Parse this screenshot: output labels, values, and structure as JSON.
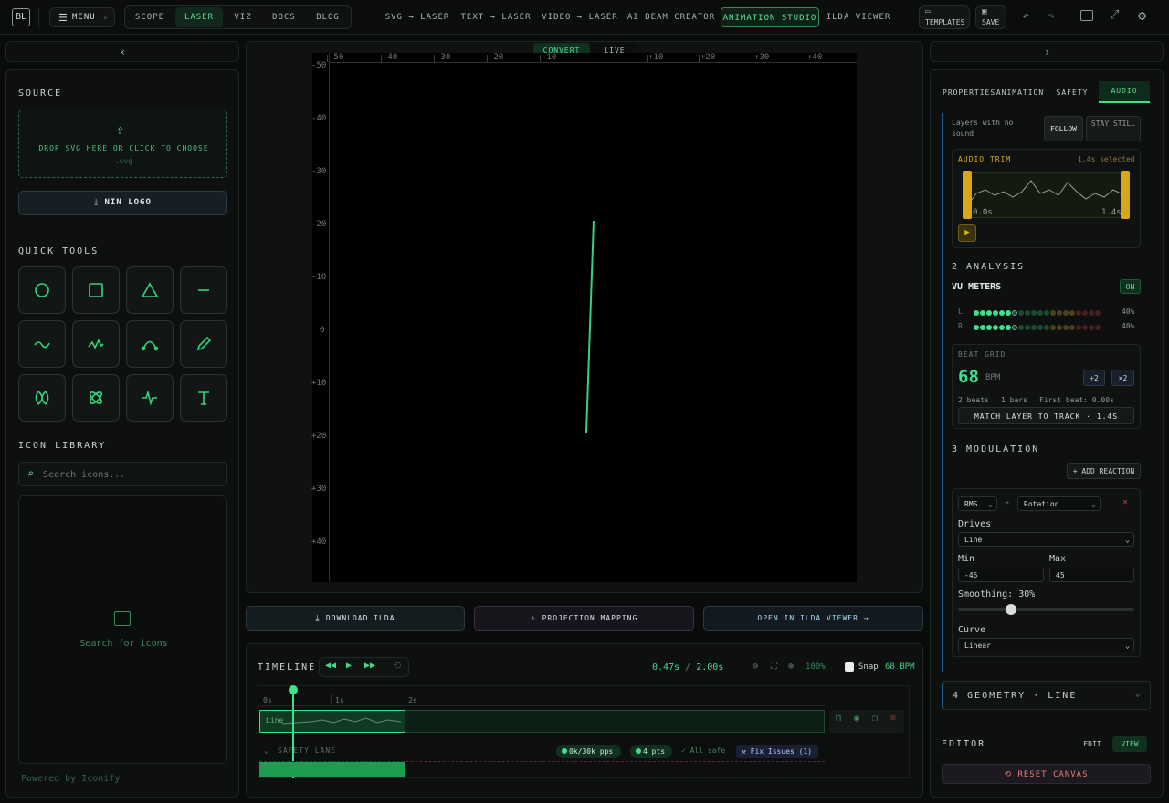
{
  "app": {
    "logo": "BL",
    "menu_label": "MENU"
  },
  "nav": {
    "primary": [
      "SCOPE",
      "LASER",
      "VIZ",
      "DOCS",
      "BLOG"
    ],
    "active": "LASER",
    "secondary": [
      "SVG → LASER",
      "TEXT → LASER",
      "VIDEO → LASER",
      "AI BEAM CREATOR",
      "ANIMATION STUDIO",
      "ILDA VIEWER"
    ],
    "secondary_active": "ANIMATION STUDIO",
    "templates": "TEMPLATES",
    "save": "SAVE"
  },
  "left": {
    "source_title": "SOURCE",
    "drop_text": "DROP SVG HERE OR CLICK TO CHOOSE",
    "drop_ext": ".svg",
    "nin_logo": "NIN LOGO",
    "quick_tools": "QUICK TOOLS",
    "tools": [
      "circle-tool-icon",
      "square-tool-icon",
      "triangle-tool-icon",
      "line-tool-icon",
      "wave-tool-icon",
      "zigzag-tool-icon",
      "arc-tool-icon",
      "pencil-tool-icon",
      "lissajous-tool-icon",
      "atom-tool-icon",
      "pulse-tool-icon",
      "text-tool-icon"
    ],
    "icon_library": "ICON LIBRARY",
    "search_placeholder": "Search icons...",
    "search_empty": "Search for icons",
    "powered": "Powered by Iconify"
  },
  "canvas": {
    "mode_tabs": [
      "CONVERT",
      "LIVE"
    ],
    "mode_active": "CONVERT",
    "x_ticks": [
      "-50",
      "-40",
      "-30",
      "-20",
      "-10",
      "+10",
      "+20",
      "+30",
      "+40"
    ],
    "y_ticks": [
      "-50",
      "-40",
      "-30",
      "-20",
      "-10",
      "0",
      "+10",
      "+20",
      "+30",
      "+40"
    ],
    "beam_color": "#34d27a",
    "download": "DOWNLOAD ILDA",
    "projection": "PROJECTION MAPPING",
    "open_viewer": "OPEN IN ILDA VIEWER →"
  },
  "timeline": {
    "title": "TIMELINE",
    "time_current": "0.47s",
    "time_sep": "/",
    "time_total": "2.00s",
    "zoom": "100%",
    "snap": "Snap",
    "bpm": "68 BPM",
    "ruler": [
      "0s",
      "1s",
      "2s"
    ],
    "clip_label": "Line",
    "safety_lane": "SAFETY LANE",
    "pps": "0k/30k pps",
    "pts": "4 pts",
    "all_safe": "✓ All safe",
    "fix": "Fix Issues (1)"
  },
  "right": {
    "tabs": [
      "PROPERTIES",
      "ANIMATION",
      "SAFETY",
      "AUDIO"
    ],
    "tab_active": "AUDIO",
    "no_sound": "Layers with no sound",
    "follow": "FOLLOW",
    "stay": "STAY STILL",
    "audio_trim": "AUDIO TRIM",
    "selected": "1.4s selected",
    "trim_start": "0.0s",
    "trim_end": "1.4s",
    "analysis": "2 ANALYSIS",
    "vu_meters": "VU METERS",
    "on": "ON",
    "vu_l": "L",
    "vu_r": "R",
    "vu_l_pct": "40%",
    "vu_r_pct": "40%",
    "vu_level": 0.4,
    "beat_grid": "BEAT GRID",
    "bpm_value": "68",
    "bpm_unit": "BPM",
    "half": "÷2",
    "double": "×2",
    "beats": "2 beats",
    "bars": "1 bars",
    "first_beat": "First beat: 0.00s",
    "match": "MATCH LAYER TO TRACK · 1.4S",
    "modulation": "3 MODULATION",
    "add_reaction": "+ ADD REACTION",
    "source_sel": "RMS",
    "target_sel": "Rotation",
    "drives": "Drives",
    "drives_val": "Line",
    "min": "Min",
    "max": "Max",
    "min_val": "-45",
    "max_val": "45",
    "smoothing": "Smoothing: 30%",
    "smoothing_level": 0.3,
    "curve": "Curve",
    "curve_val": "Linear",
    "geometry": "4 GEOMETRY · LINE",
    "editor": "EDITOR",
    "edit": "EDIT",
    "view": "VIEW",
    "reset": "RESET CANVAS"
  }
}
